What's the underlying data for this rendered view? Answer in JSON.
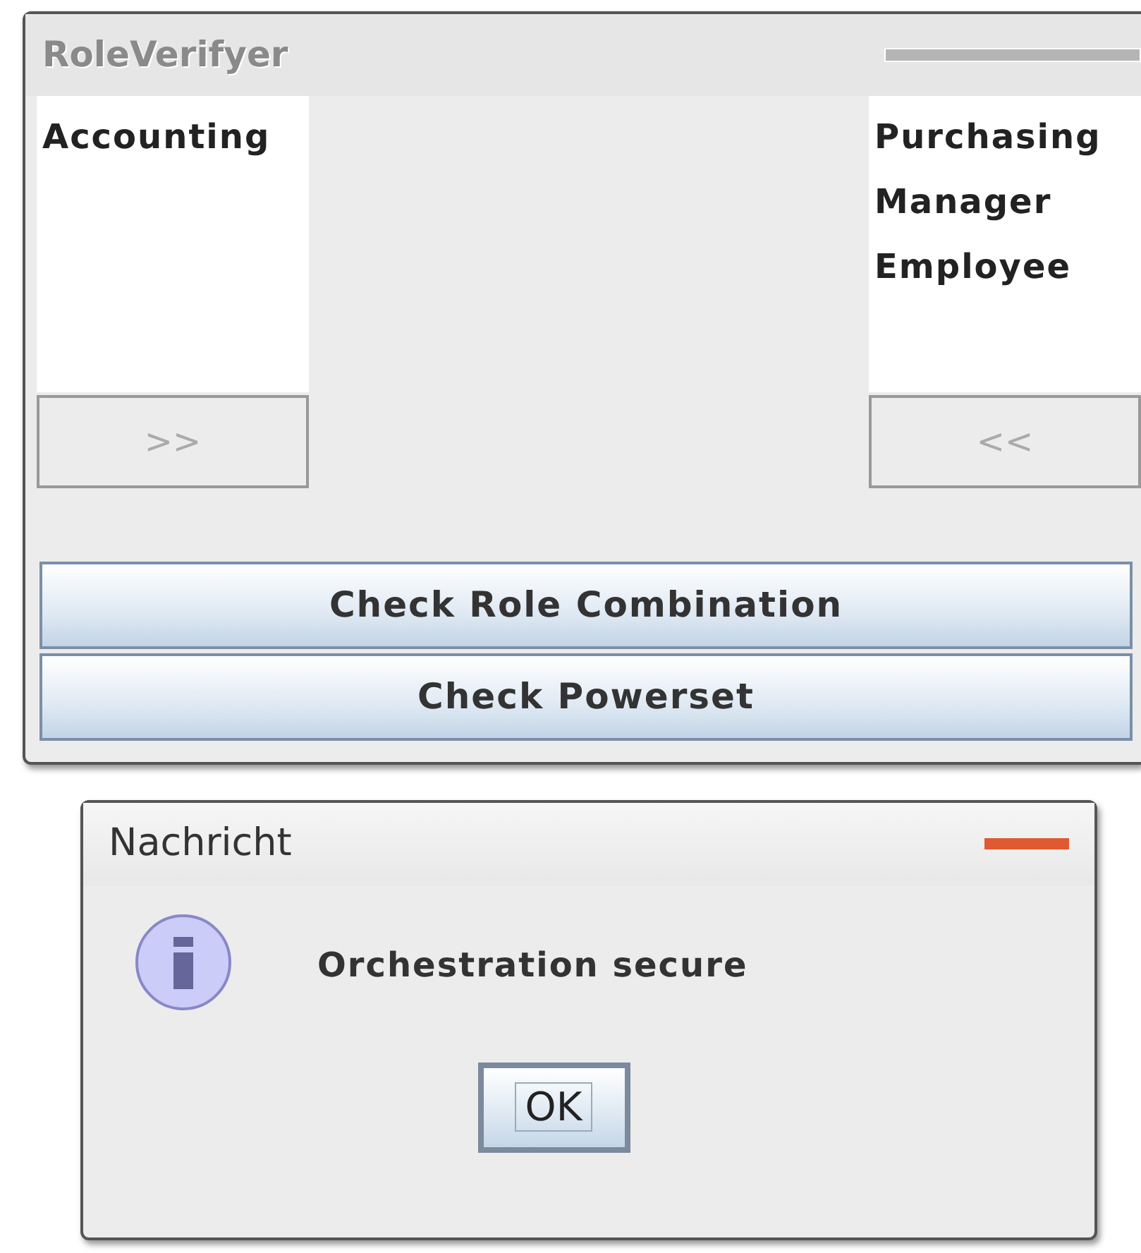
{
  "main_window": {
    "title": "RoleVerifyer",
    "active": false,
    "left_list": {
      "items": [
        {
          "label": "Accounting",
          "selected": false
        }
      ]
    },
    "right_list": {
      "items": [
        {
          "label": "Purchasing",
          "selected": false
        },
        {
          "label": "Manager",
          "selected": false
        },
        {
          "label": "Employee",
          "selected": false
        }
      ]
    },
    "move_right_button": {
      "label": ">>",
      "disabled": true
    },
    "move_left_button": {
      "label": "<<",
      "disabled": true
    },
    "buttons": [
      {
        "label": "Check Role Combination"
      },
      {
        "label": "Check Powerset"
      }
    ]
  },
  "dialog": {
    "title": "Nachricht",
    "active": true,
    "message": "Orchestration secure",
    "button": {
      "label": "OK",
      "focused": true
    }
  }
}
